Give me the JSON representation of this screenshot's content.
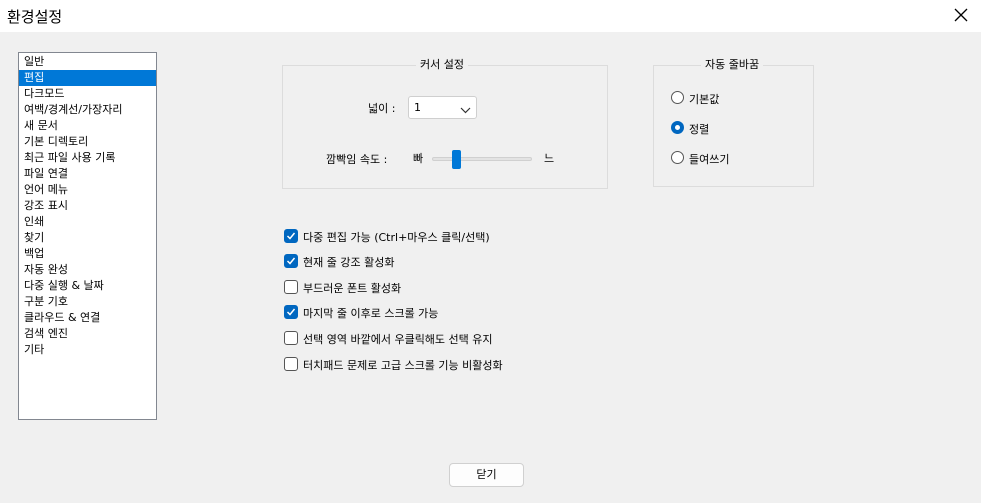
{
  "window": {
    "title": "환경설정",
    "close_icon": "close-icon"
  },
  "categories": [
    "일반",
    "편집",
    "다크모드",
    "여백/경계선/가장자리",
    "새 문서",
    "기본 디렉토리",
    "최근 파일 사용 기록",
    "파일 연결",
    "언어 메뉴",
    "강조 표시",
    "인쇄",
    "찾기",
    "백업",
    "자동 완성",
    "다중 실행 & 날짜",
    "구분 기호",
    "클라우드 & 연결",
    "검색 엔진",
    "기타"
  ],
  "selected_category": "편집",
  "cursor": {
    "group_title": "커서 설정",
    "width_label": "넓이 :",
    "width_value": "1",
    "blink_label": "깜빡임 속도 :",
    "blink_fast": "빠",
    "blink_slow": "느",
    "blink_level": 0.25
  },
  "wrap": {
    "group_title": "자동 줄바꿈",
    "options": [
      "기본값",
      "정렬",
      "들여쓰기"
    ],
    "selected": "정렬"
  },
  "checkboxes": [
    {
      "label": "다중 편집 가능 (Ctrl+마우스 클릭/선택)",
      "checked": true
    },
    {
      "label": "현재 줄 강조 활성화",
      "checked": true
    },
    {
      "label": "부드러운 폰트 활성화",
      "checked": false
    },
    {
      "label": "마지막 줄 이후로 스크롤 가능",
      "checked": true
    },
    {
      "label": "선택 영역 바깥에서 우클릭해도 선택 유지",
      "checked": false
    },
    {
      "label": "터치패드 문제로 고급 스크롤 기능 비활성화",
      "checked": false
    }
  ],
  "close_button": "닫기",
  "accent_color": "#0067c0"
}
